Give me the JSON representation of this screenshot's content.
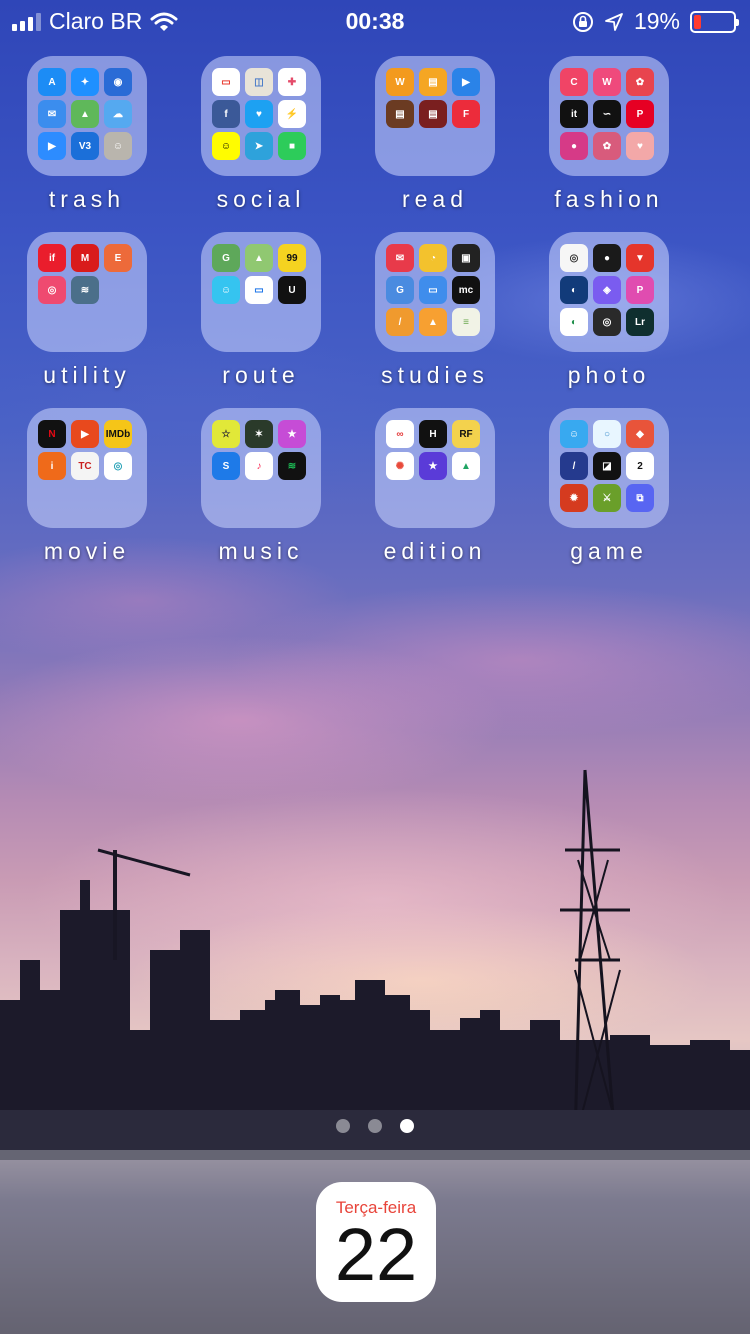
{
  "status_bar": {
    "carrier": "Claro BR",
    "time": "00:38",
    "battery_percent": "19%",
    "battery_level": 0.19,
    "battery_color": "#ff3b30"
  },
  "folders": [
    {
      "label": "trash",
      "apps": [
        "App Store",
        "Safari",
        "1Password",
        "Mail",
        "Maps",
        "Weather",
        "Zoom",
        "V3",
        "Contacts"
      ]
    },
    {
      "label": "social",
      "apps": [
        "Party",
        "Followers",
        "Slack",
        "Facebook",
        "Twitter",
        "Messenger",
        "Snapchat",
        "Telegram",
        "FaceTime"
      ]
    },
    {
      "label": "read",
      "apps": [
        "Wattpad",
        "Books",
        "Video",
        "Holy Bible",
        "Bible",
        "Flipboard"
      ]
    },
    {
      "label": "fashion",
      "apps": [
        "C",
        "W",
        "Settings",
        "it",
        "Sketch",
        "Pinterest",
        "Dot",
        "Photo Pink",
        "Heart"
      ]
    },
    {
      "label": "utility",
      "apps": [
        "iFood",
        "Minha Claro",
        "E",
        "Airdrop",
        "Wifi"
      ]
    },
    {
      "label": "route",
      "apps": [
        "Google Maps",
        "Maps",
        "99",
        "Waze",
        "Bus",
        "Uber"
      ]
    },
    {
      "label": "studies",
      "apps": [
        "Mail",
        "Tips",
        "Education",
        "Translate",
        "Keynote",
        "Mente",
        "Notes",
        "Scholar",
        "Notebook"
      ]
    },
    {
      "label": "photo",
      "apps": [
        "Aperture",
        "Camera",
        "Vivino",
        "Circle",
        "Glitch",
        "PicsArt",
        "Snapseed",
        "Lens",
        "Lr"
      ]
    },
    {
      "label": "movie",
      "apps": [
        "Netflix",
        "Play",
        "IMDb",
        "Ingresso",
        "Telecine Play",
        "Eye"
      ]
    },
    {
      "label": "music",
      "apps": [
        "Star",
        "Dancer",
        "iTunes Store",
        "Shazam",
        "Music",
        "Spotify"
      ]
    },
    {
      "label": "edition",
      "apps": [
        "Infinity",
        "HUJI",
        "Revela Facil",
        "Photos",
        "iMovie",
        "Drive"
      ]
    },
    {
      "label": "game",
      "apps": [
        "Face",
        "Loop",
        "Cube",
        "Tiles",
        "Jar",
        "2048",
        "Fruit",
        "Slice",
        "Discord"
      ]
    }
  ],
  "mini_icons": {
    "0": [
      [
        "#1c8cf5",
        "A"
      ],
      [
        "#1e90ff",
        "✦"
      ],
      [
        "#2a6bd6",
        "◉"
      ],
      [
        "#3b8dee",
        "✉"
      ],
      [
        "#5fb85a",
        "▲"
      ],
      [
        "#55a9f0",
        "☁"
      ],
      [
        "#2d8cff",
        "▶"
      ],
      [
        "#1b6fd9",
        "V3"
      ],
      [
        "#b9b5ad",
        "☺"
      ]
    ],
    "1": [
      [
        "#ffffff",
        "▭",
        "#e8392e"
      ],
      [
        "#e8e3d8",
        "◫",
        "#4a7bc8"
      ],
      [
        "#ffffff",
        "✚",
        "#e44c6a"
      ],
      [
        "#3b5998",
        "f"
      ],
      [
        "#1da1f2",
        "♥"
      ],
      [
        "#ffffff",
        "⚡",
        "#1f7df2"
      ],
      [
        "#fffc00",
        "☺",
        "#000"
      ],
      [
        "#2ea2db",
        "➤"
      ],
      [
        "#2dcc5a",
        "■"
      ]
    ],
    "2": [
      [
        "#f39a1e",
        "W"
      ],
      [
        "#f5a623",
        "▤"
      ],
      [
        "#2a83e8",
        "▶"
      ],
      [
        "#6b3b22",
        "▤"
      ],
      [
        "#7a1f1f",
        "▤"
      ],
      [
        "#ec2c3b",
        "F"
      ]
    ],
    "3": [
      [
        "#f04466",
        "C"
      ],
      [
        "#ef4a7c",
        "W"
      ],
      [
        "#e8444e",
        "✿"
      ],
      [
        "#111111",
        "it"
      ],
      [
        "#111111",
        "∽"
      ],
      [
        "#e60023",
        "P"
      ],
      [
        "#d63a87",
        "●"
      ],
      [
        "#d85b7c",
        "✿"
      ],
      [
        "#f3a8a8",
        "♥"
      ]
    ],
    "4": [
      [
        "#ea1d2c",
        "if"
      ],
      [
        "#d91b1b",
        "M"
      ],
      [
        "#ed6a3a",
        "E"
      ],
      [
        "#ef4a70",
        "◎"
      ],
      [
        "#4b6f8a",
        "≋"
      ]
    ],
    "5": [
      [
        "#5ea85a",
        "G"
      ],
      [
        "#90c871",
        "▲"
      ],
      [
        "#f5d320",
        "99",
        "#111"
      ],
      [
        "#35c4f0",
        "☺"
      ],
      [
        "#ffffff",
        "▭",
        "#1a73e8"
      ],
      [
        "#111111",
        "U"
      ]
    ],
    "6": [
      [
        "#e83a4a",
        "✉"
      ],
      [
        "#f3c22d",
        "◔"
      ],
      [
        "#222222",
        "▣"
      ],
      [
        "#4a8be0",
        "G"
      ],
      [
        "#3f8dec",
        "▭"
      ],
      [
        "#111111",
        "mc"
      ],
      [
        "#f09a2e",
        "/"
      ],
      [
        "#f7a031",
        "▲"
      ],
      [
        "#f1f3e6",
        "≡",
        "#6aa84f"
      ]
    ],
    "7": [
      [
        "#f6f6f6",
        "◎",
        "#333"
      ],
      [
        "#1a1a1a",
        "●"
      ],
      [
        "#e5352b",
        "▼"
      ],
      [
        "#123b7a",
        "◐"
      ],
      [
        "#7a5cf0",
        "◈"
      ],
      [
        "#e04cb0",
        "P"
      ],
      [
        "#ffffff",
        "◐",
        "#1e8f4a"
      ],
      [
        "#2a2a2a",
        "◎"
      ],
      [
        "#0f2f2f",
        "Lr"
      ]
    ],
    "8": [
      [
        "#111111",
        "N",
        "#e50914"
      ],
      [
        "#e8491d",
        "▶"
      ],
      [
        "#f5c518",
        "IMDb",
        "#111"
      ],
      [
        "#ef6a1a",
        "i"
      ],
      [
        "#f4f4f4",
        "TC",
        "#c81e1e"
      ],
      [
        "#ffffff",
        "◎",
        "#27a2b7"
      ]
    ],
    "9": [
      [
        "#e1e838",
        "☆",
        "#333"
      ],
      [
        "#2a3a2a",
        "✶"
      ],
      [
        "#c64cd6",
        "★"
      ],
      [
        "#1e7ae8",
        "S"
      ],
      [
        "#ffffff",
        "♪",
        "#fa2d55"
      ],
      [
        "#111111",
        "≋",
        "#1db954"
      ]
    ],
    "10": [
      [
        "#ffffff",
        "∞",
        "#e43a3a"
      ],
      [
        "#111111",
        "H"
      ],
      [
        "#f3d24d",
        "RF",
        "#111"
      ],
      [
        "#ffffff",
        "✺",
        "#e84a3a"
      ],
      [
        "#5a3bd8",
        "★"
      ],
      [
        "#ffffff",
        "▲",
        "#1fa463"
      ]
    ],
    "11": [
      [
        "#38a9f0",
        "☺"
      ],
      [
        "#e8f6ff",
        "○",
        "#3a8dcc"
      ],
      [
        "#e8543a",
        "◆"
      ],
      [
        "#253a8e",
        "/"
      ],
      [
        "#111111",
        "◪"
      ],
      [
        "#ffffff",
        "2",
        "#111"
      ],
      [
        "#d53b1f",
        "✹"
      ],
      [
        "#6a9f2a",
        "⚔"
      ],
      [
        "#5865f2",
        "⧉"
      ]
    ]
  },
  "page_dots": 3,
  "active_page": 3,
  "dock": {
    "calendar": {
      "weekday": "Terça-feira",
      "date": "22"
    }
  }
}
